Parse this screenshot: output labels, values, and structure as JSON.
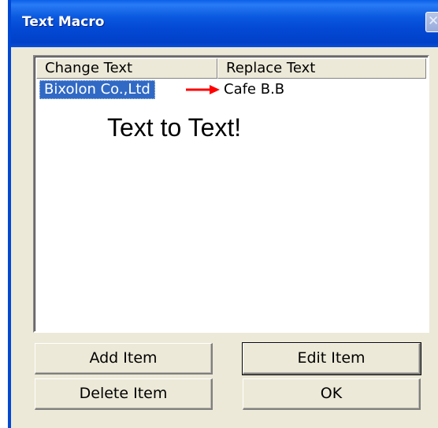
{
  "window": {
    "title": "Text Macro",
    "close_glyph": "✕"
  },
  "list": {
    "columns": [
      "Change Text",
      "Replace Text"
    ],
    "rows": [
      {
        "change": "Bixolon Co.,Ltd",
        "replace": "Cafe B.B",
        "selected": true
      }
    ]
  },
  "annotation": {
    "text": "Text to Text!",
    "arrow_color": "#ff0000"
  },
  "buttons": {
    "add": "Add Item",
    "edit": "Edit Item",
    "delete": "Delete Item",
    "ok": "OK"
  },
  "colors": {
    "titlebar": "#0349d4",
    "selection": "#316ac5",
    "dialog_bg": "#ece9d8"
  }
}
